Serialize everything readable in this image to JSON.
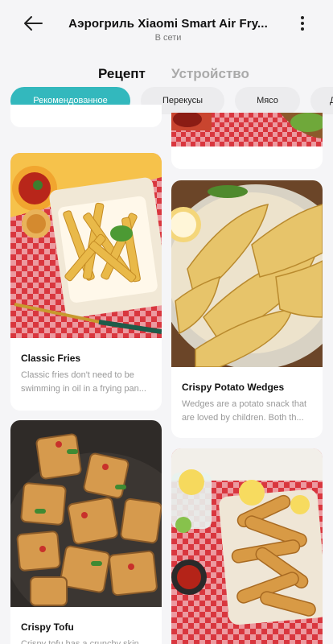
{
  "header": {
    "title": "Аэрогриль Xiaomi Smart Air Fry...",
    "status": "В сети",
    "back_icon": "arrow-left-icon",
    "more_icon": "more-vertical-icon"
  },
  "main_tabs": [
    {
      "label": "Рецепт",
      "active": true
    },
    {
      "label": "Устройство",
      "active": false
    }
  ],
  "chips": [
    {
      "label": "Рекомендованное",
      "active": true
    },
    {
      "label": "Перекусы",
      "active": false
    },
    {
      "label": "Мясо",
      "active": false
    },
    {
      "label": "Д",
      "active": false
    }
  ],
  "cards": [
    {
      "title": "Classic Fries",
      "desc_line1": "Classic fries don't need to be",
      "desc_line2": "swimming in oil in a frying pan..."
    },
    {
      "title": "Crispy Potato Wedges",
      "desc_line1": "Wedges are a potato snack that",
      "desc_line2": "are loved by children. Both th..."
    },
    {
      "title": "Crispy Tofu",
      "desc_line1": "Crispy tofu has a crunchy skin"
    }
  ],
  "colors": {
    "accent": "#33b8bd",
    "background": "#f5f5f7",
    "chip_inactive": "#ececee"
  }
}
